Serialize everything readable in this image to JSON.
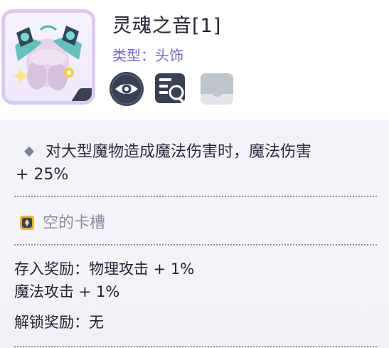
{
  "item": {
    "name": "灵魂之音[1]",
    "type_line": "类型：头饰",
    "icon": "soul-voice-headgear-icon"
  },
  "actions": [
    {
      "icon": "eye-icon"
    },
    {
      "icon": "detail-search-icon"
    },
    {
      "icon": "tray-icon"
    }
  ],
  "effect": {
    "line1": "对大型魔物造成魔法伤害时，魔法伤害",
    "line2": "+ 25%"
  },
  "card_slot": {
    "label": "空的卡槽",
    "icon": "card-slot-icon",
    "color": "#e0b33c"
  },
  "deposit_reward": {
    "line1": "存入奖励：物理攻击 + 1%",
    "line2": "魔法攻击 + 1%"
  },
  "unlock_reward": {
    "text": "解锁奖励：无"
  },
  "colors": {
    "accent_purple": "#7a64c6",
    "icon_dark": "#3b4154",
    "disabled_gray": "#bfc3cc",
    "panel_bg": "#f2f2f7"
  }
}
